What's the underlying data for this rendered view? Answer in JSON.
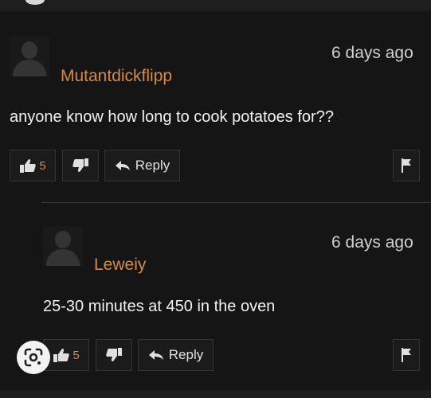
{
  "comments": [
    {
      "username": "Mutantdickflipp",
      "time": "6 days ago",
      "text": "anyone know how long to cook potatoes for??",
      "likes": "5",
      "reply_label": "Reply"
    },
    {
      "username": "Leweiy",
      "time": "6 days ago",
      "text": "25-30 minutes at 450 in the oven",
      "likes": "5",
      "reply_label": "Reply"
    }
  ],
  "icons": {
    "like": "thumbs-up-icon",
    "dislike": "thumbs-down-icon",
    "reply": "reply-arrow-icon",
    "flag": "flag-icon",
    "lens": "google-lens-icon"
  },
  "colors": {
    "background": "#151515",
    "username": "#d48a4a",
    "text": "#f2f2f2"
  }
}
